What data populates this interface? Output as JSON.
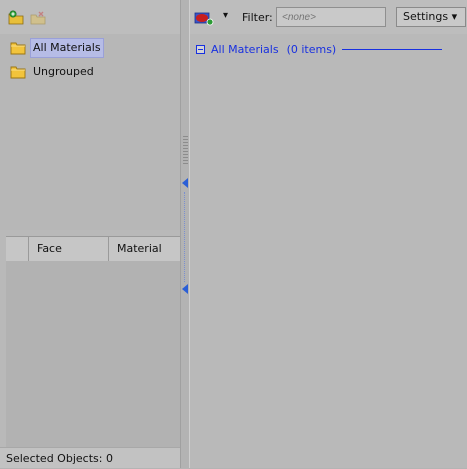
{
  "left_toolbar": {
    "icons": [
      "add-group-icon",
      "remove-group-icon"
    ]
  },
  "tree": {
    "items": [
      {
        "label": "All Materials",
        "icon": "folder-icon",
        "selected": true
      },
      {
        "label": "Ungrouped",
        "icon": "folder-icon",
        "selected": false
      }
    ]
  },
  "table": {
    "columns": [
      "Face",
      "Material"
    ]
  },
  "status": {
    "selected_objects": "Selected Objects: 0"
  },
  "right_toolbar": {
    "filter_label": "Filter:",
    "filter_placeholder": "<none>",
    "settings_label": "Settings ▾",
    "dropdown_arrow": "▾"
  },
  "content": {
    "group_label": "All Materials",
    "group_count": "(0 items)"
  },
  "colors": {
    "accent": "#1830e0",
    "selection": "#b6bce6",
    "folder": "#f2c43c"
  }
}
